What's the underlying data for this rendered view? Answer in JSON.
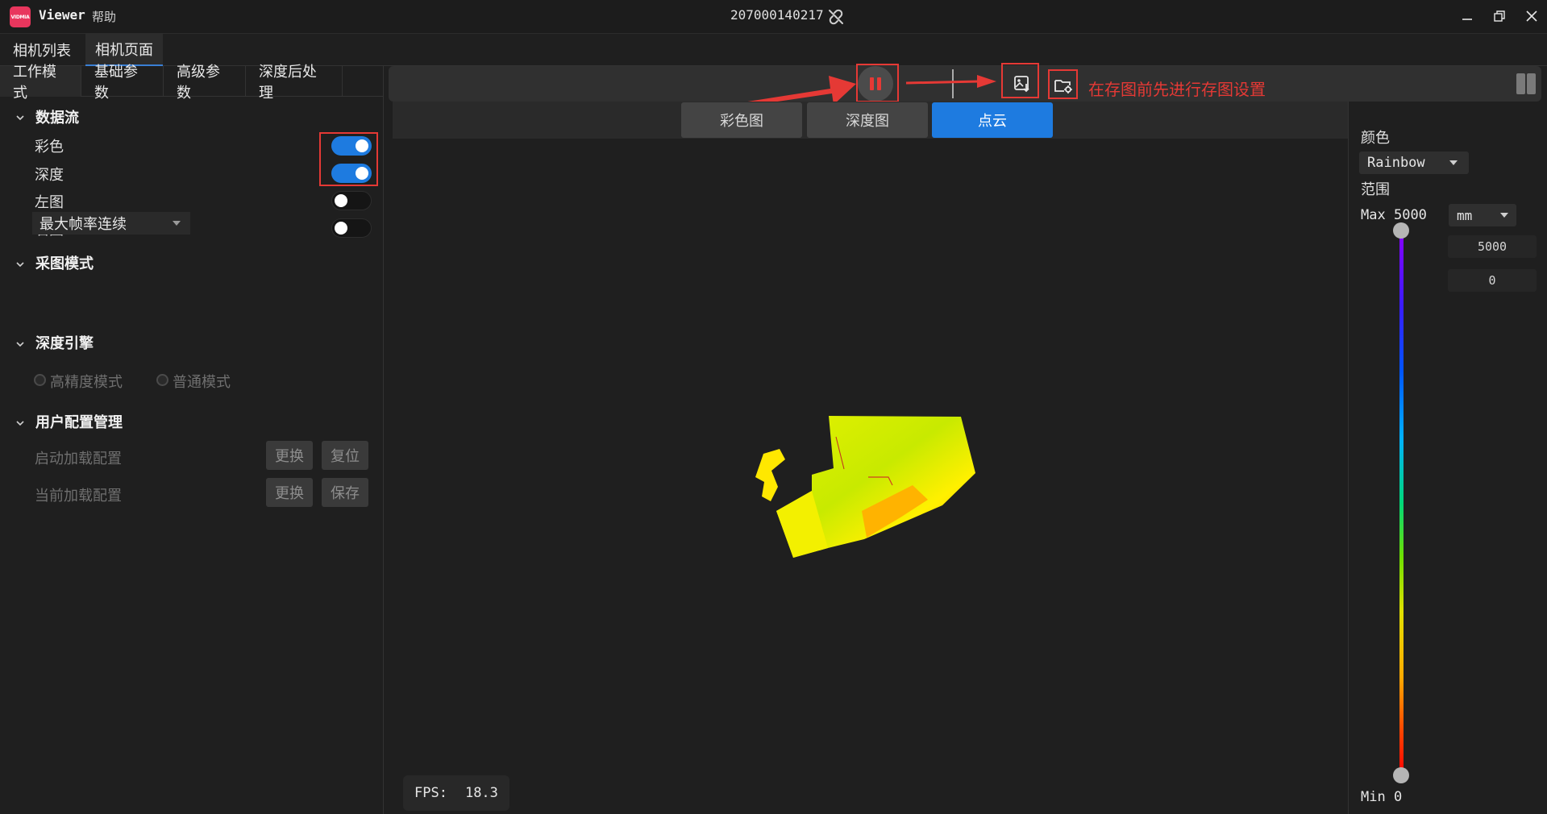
{
  "app": {
    "logo_text": "VIDMIA",
    "name": "Viewer",
    "help_menu": "帮助",
    "device_id": "207000140217"
  },
  "top_tabs": [
    {
      "label": "相机列表",
      "active": false
    },
    {
      "label": "相机页面",
      "active": true
    }
  ],
  "sub_tabs": [
    {
      "label": "工作模式",
      "active": true
    },
    {
      "label": "基础参数",
      "active": false
    },
    {
      "label": "高级参数",
      "active": false
    },
    {
      "label": "深度后处理",
      "active": false
    }
  ],
  "data_stream": {
    "title": "数据流",
    "items": [
      {
        "label": "彩色",
        "on": true
      },
      {
        "label": "深度",
        "on": true
      },
      {
        "label": "左图",
        "on": false
      },
      {
        "label": "右图",
        "on": false
      }
    ]
  },
  "capture_mode": {
    "title": "采图模式",
    "selected": "最大帧率连续"
  },
  "depth_engine": {
    "title": "深度引擎",
    "options": [
      "高精度模式",
      "普通模式"
    ]
  },
  "user_config": {
    "title": "用户配置管理",
    "rows": [
      {
        "label": "启动加载配置",
        "btn1": "更换",
        "btn2": "复位"
      },
      {
        "label": "当前加载配置",
        "btn1": "更换",
        "btn2": "保存"
      }
    ]
  },
  "toolbar": {
    "hint": "在存图前先进行存图设置"
  },
  "view_tabs": [
    {
      "label": "彩色图",
      "active": false
    },
    {
      "label": "深度图",
      "active": false
    },
    {
      "label": "点云",
      "active": true
    }
  ],
  "fps": {
    "label": "FPS:",
    "value": "18.3"
  },
  "right_panel": {
    "color_label": "颜色",
    "color_value": "Rainbow",
    "range_label": "范围",
    "max_label": "Max",
    "max_value": "5000",
    "unit": "mm",
    "max_input": "5000",
    "min_input": "0",
    "min_label": "Min",
    "min_value": "0"
  },
  "colors": {
    "accent": "#1e7be0",
    "annotation_red": "#e53935",
    "background": "#1f1f1f"
  },
  "icons": [
    "unlink-icon",
    "minimize-icon",
    "restore-icon",
    "close-icon",
    "pause-icon",
    "save-image-icon",
    "save-settings-folder-icon",
    "panel-toggle-icon",
    "chevron-down-icon",
    "dropdown-caret-icon"
  ]
}
